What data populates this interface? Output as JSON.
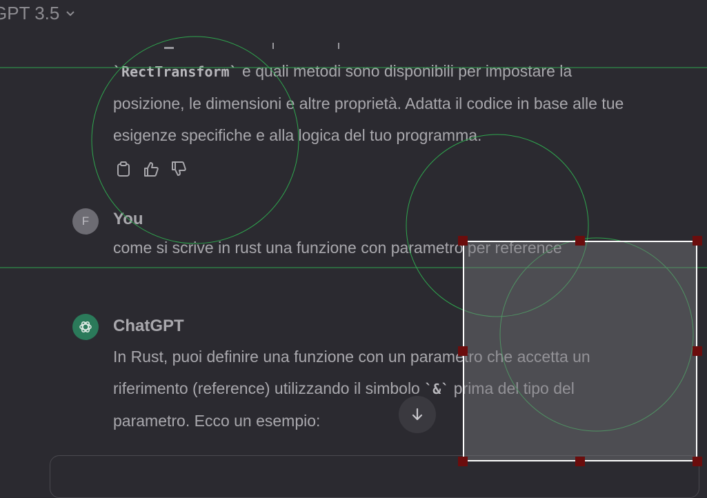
{
  "header": {
    "model_label": "GPT 3.5",
    "chevron_icon": "chevron-down-icon"
  },
  "message_prev": {
    "code_inline": "`RectTransform`",
    "line1_rest": " e quali metodi sono disponibili per impostare la",
    "line2": "posizione, le dimensioni e altre proprietà. Adatta il codice in base alle tue",
    "line3": "esigenze specifiche e alla logica del tuo programma.",
    "actions": [
      "clipboard-icon",
      "thumbs-up-icon",
      "thumbs-down-icon"
    ]
  },
  "message_user": {
    "avatar_letter": "F",
    "author": "You",
    "text": "come si scrive in rust una funzione con parametro per reference"
  },
  "message_assistant": {
    "author": "ChatGPT",
    "line1": "In Rust, puoi definire una funzione con un parametro che accetta un",
    "line2_start": "riferimento (reference) utilizzando il simbolo ",
    "code_inline": "`&`",
    "line2_end": " prima del tipo del",
    "line3": "parametro. Ecco un esempio:"
  },
  "scroll_button": {
    "icon": "arrow-down-icon"
  },
  "colors": {
    "background": "#2b2a30",
    "overlay_green": "#2fa84f",
    "handle": "#6b0d0d",
    "gpt_avatar": "#2b7a5a"
  }
}
